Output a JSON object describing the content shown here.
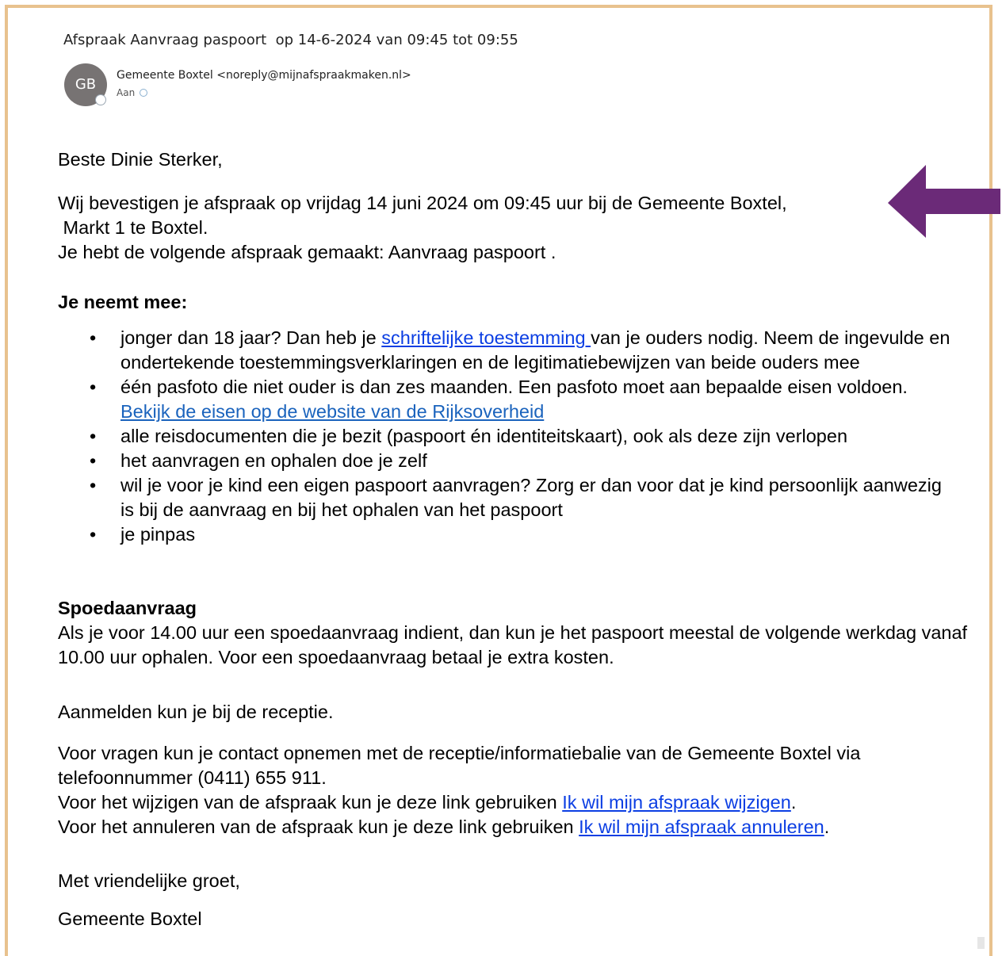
{
  "email": {
    "subject": "Afspraak Aanvraag paspoort  op 14-6-2024 van 09:45 tot 09:55",
    "avatar_initials": "GB",
    "sender": "Gemeente Boxtel <noreply@mijnafspraakmaken.nl>",
    "to_label": "Aan"
  },
  "body": {
    "greeting": "Beste Dinie Sterker,",
    "confirm_line1": "Wij bevestigen je afspraak op vrijdag 14 juni 2024 om 09:45 uur bij de Gemeente Boxtel,",
    "confirm_line2": " Markt 1 te Boxtel.",
    "confirm_line3": "Je hebt de volgende afspraak gemaakt: Aanvraag paspoort .",
    "bring_heading": "Je neemt mee:",
    "items": {
      "item1_before": "jonger dan 18 jaar? Dan heb je ",
      "item1_link": "schriftelijke toestemming ",
      "item1_after": "van je ouders nodig.  Neem de ingevulde en ondertekende toestemmingsverklaringen en de legitimatiebewijzen van beide ouders mee",
      "item2_before": "één pasfoto die niet ouder is dan zes maanden. Een pasfoto moet aan bepaalde eisen voldoen. ",
      "item2_link": "Bekijk de eisen op de website van de Rijksoverheid",
      "item3": "alle reisdocumenten die je bezit (paspoort én identiteitskaart), ook als deze zijn verlopen",
      "item4": "het aanvragen en ophalen doe je zelf",
      "item5": "wil je voor je kind een eigen paspoort aanvragen? Zorg er dan voor dat je kind persoonlijk aanwezig is bij de aanvraag en bij het ophalen van het paspoort",
      "item6": "je pinpas",
      "bullet": "•"
    },
    "spoed_heading": "Spoedaanvraag",
    "spoed_text": "Als je voor 14.00 uur een spoedaanvraag indient, dan kun je het paspoort meestal de volgende werkdag vanaf 10.00 uur ophalen. Voor een spoedaanvraag betaal je extra kosten.",
    "reception": "Aanmelden kun je bij de receptie.",
    "questions": "Voor vragen kun je contact opnemen met de receptie/informatiebalie van de Gemeente Boxtel via telefoonnummer (0411) 655 911.",
    "change_text": "Voor het wijzigen van de afspraak kun je deze link gebruiken ",
    "change_link": "Ik wil mijn afspraak wijzigen",
    "cancel_text": "Voor het annuleren van de afspraak kun je deze link gebruiken ",
    "cancel_link": "Ik wil mijn afspraak annuleren",
    "period": ".",
    "closing": "Met vriendelijke groet,",
    "signature": "Gemeente Boxtel"
  },
  "colors": {
    "frame_border": "#e8c28e",
    "arrow": "#6b2a78",
    "link": "#0b3ee3",
    "avatar": "#777373"
  },
  "icons": {
    "annotation_arrow": "left-arrow-icon",
    "presence": "presence-status-icon"
  }
}
